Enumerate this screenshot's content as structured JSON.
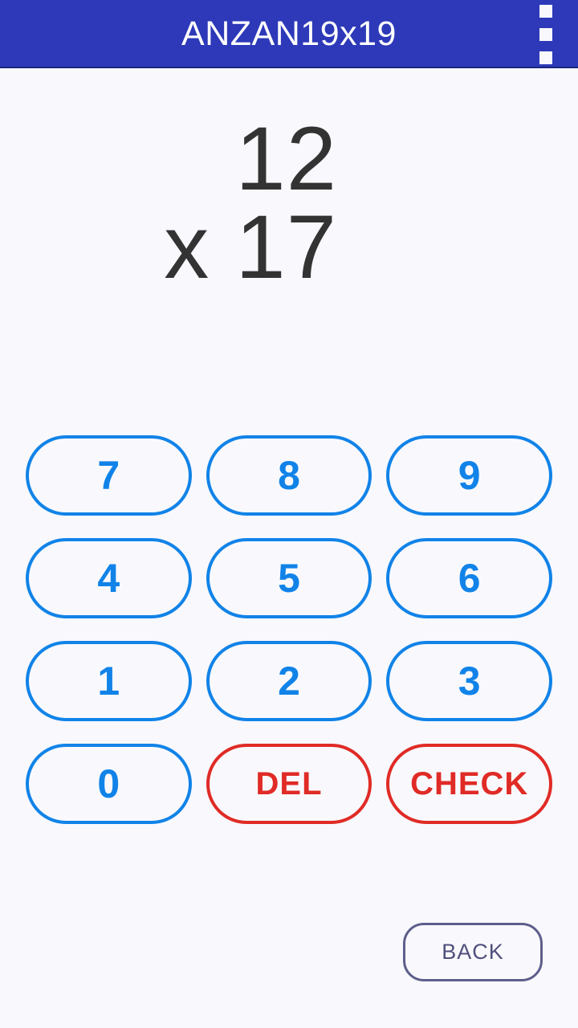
{
  "app_bar": {
    "title": "ANZAN19x19",
    "background_color": "#2d39b8",
    "title_color": "#ffffff",
    "overflow_menu_icon": "overflow-menu-icon"
  },
  "problem": {
    "multiplicand": "12",
    "multiplier": "x 17",
    "operator": "x",
    "operand_a": "12",
    "operand_b": "17",
    "text_color": "#333333"
  },
  "keypad": {
    "number_color": "#1183e8",
    "action_color": "#e02b26",
    "rows": [
      [
        {
          "label": "7",
          "kind": "number",
          "name": "key-7"
        },
        {
          "label": "8",
          "kind": "number",
          "name": "key-8"
        },
        {
          "label": "9",
          "kind": "number",
          "name": "key-9"
        }
      ],
      [
        {
          "label": "4",
          "kind": "number",
          "name": "key-4"
        },
        {
          "label": "5",
          "kind": "number",
          "name": "key-5"
        },
        {
          "label": "6",
          "kind": "number",
          "name": "key-6"
        }
      ],
      [
        {
          "label": "1",
          "kind": "number",
          "name": "key-1"
        },
        {
          "label": "2",
          "kind": "number",
          "name": "key-2"
        },
        {
          "label": "3",
          "kind": "number",
          "name": "key-3"
        }
      ],
      [
        {
          "label": "0",
          "kind": "number",
          "name": "key-0"
        },
        {
          "label": "DEL",
          "kind": "action",
          "name": "key-delete"
        },
        {
          "label": "CHECK",
          "kind": "action",
          "name": "key-check"
        }
      ]
    ]
  },
  "back_button": {
    "label": "BACK",
    "border_color": "#5e5e8c",
    "text_color": "#50507d"
  },
  "page": {
    "background_color": "#f8f8fd"
  }
}
